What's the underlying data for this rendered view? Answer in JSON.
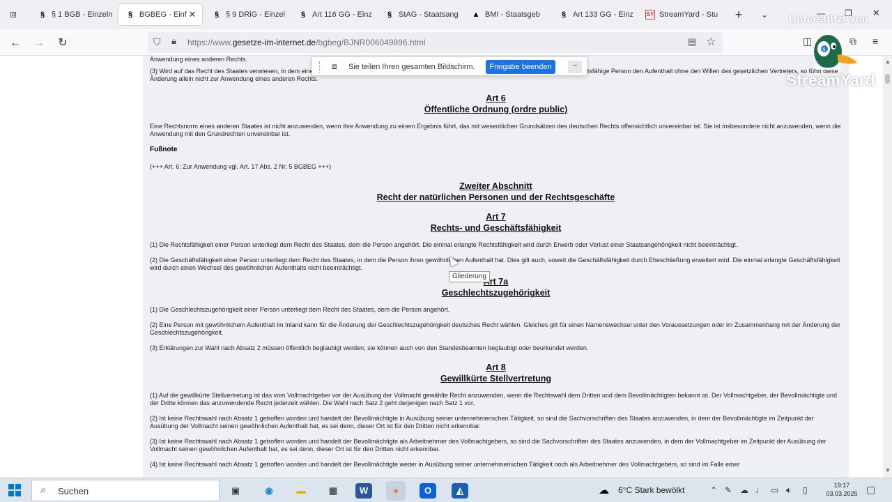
{
  "browser": {
    "tabs": [
      {
        "label": "§ 1 BGB - Einzeln",
        "icon": "gesetze-icon"
      },
      {
        "label": "BGBEG - Einfü",
        "icon": "gesetze-icon",
        "active": true
      },
      {
        "label": "§ 9 DRiG - Einzel",
        "icon": "gesetze-icon"
      },
      {
        "label": "Art 116 GG - Einz",
        "icon": "gesetze-icon"
      },
      {
        "label": "StAG - Staatsang",
        "icon": "gesetze-icon"
      },
      {
        "label": "BMI - Staatsgeb",
        "icon": "bmi-icon"
      },
      {
        "label": "Art 133 GG - Einz",
        "icon": "gesetze-icon"
      },
      {
        "label": "StreamYard - Stu",
        "icon": "streamyard-icon"
      }
    ],
    "tab_favicon_text": "§",
    "streamyard_favicon_text": "SY",
    "url_prefix": "https://www.",
    "url_domain": "gesetze-im-internet.de",
    "url_path": "/bgbeg/BJNR006049896.html"
  },
  "watermarks": {
    "support": "Unterstützt von",
    "brand": "StreamYard"
  },
  "share_bar": {
    "message": "Sie teilen Ihren gesamten Bildschirm.",
    "stop_button": "Freigabe beenden",
    "hide_button": "–"
  },
  "document": {
    "top_fragment": "Anwendung eines anderen Rechts.",
    "art5_para3": "(3) Wird auf das Recht des Staates verwiesen, in dem eine Person ihren Aufenthalt oder ihren gewöhnlichen Aufenthalt hat, und ändert eine nicht voll geschäftsfähige Person den Aufenthalt ohne den Willen des gesetzlichen Vertreters, so führt diese Änderung allein nicht zur Anwendung eines anderen Rechts.",
    "art6": {
      "number": "Art 6",
      "title": "Öffentliche Ordnung (ordre public)",
      "text": "Eine Rechtsnorm eines anderen Staates ist nicht anzuwenden, wenn ihre Anwendung zu einem Ergebnis führt, das mit wesentlichen Grundsätzen des deutschen Rechts offensichtlich unvereinbar ist. Sie ist insbesondere nicht anzuwenden, wenn die Anwendung mit den Grundrechten unvereinbar ist.",
      "footnote_label": "Fußnote",
      "footnote_text": "(+++ Art. 6: Zur Anwendung vgl. Art. 17 Abs. 2 Nr. 5 BGBEG +++)"
    },
    "section2": {
      "number": "Zweiter Abschnitt",
      "title": "Recht der natürlichen Personen und der Rechtsgeschäfte"
    },
    "art7": {
      "number": "Art 7",
      "title": "Rechts- und Geschäftsfähigkeit",
      "p1": "(1) Die Rechtsfähigkeit einer Person unterliegt dem Recht des Staates, dem die Person angehört. Die einmal erlangte Rechtsfähigkeit wird durch Erwerb oder Verlust einer Staatsangehörigkeit nicht beeinträchtigt.",
      "p2": "(2) Die Geschäftsfähigkeit einer Person unterliegt dem Recht des Staates, in dem die Person ihren gewöhnlichen Aufenthalt hat. Dies gilt auch, soweit die Geschäftsfähigkeit durch Eheschließung erweitert wird. Die einmal erlangte Geschäftsfähigkeit wird durch einen Wechsel des gewöhnlichen Aufenthalts nicht beeinträchtigt."
    },
    "art7a": {
      "number": "Art 7a",
      "title": "Geschlechtszugehörigkeit",
      "p1": "(1) Die Geschlechtszugehörigkeit einer Person unterliegt dem Recht des Staates, dem die Person angehört.",
      "p2": "(2) Eine Person mit gewöhnlichem Aufenthalt im Inland kann für die Änderung der Geschlechtszugehörigkeit deutsches Recht wählen. Gleiches gilt für einen Namenswechsel unter den Voraussetzungen oder im Zusammenhang mit der Änderung der Geschlechtszugehörigkeit.",
      "p3": "(3) Erklärungen zur Wahl nach Absatz 2 müssen öffentlich beglaubigt werden; sie können auch von den Standesbeamten beglaubigt oder beurkundet werden."
    },
    "art8": {
      "number": "Art 8",
      "title": "Gewillkürte Stellvertretung",
      "p1": "(1) Auf die gewillkürte Stellvertretung ist das vom Vollmachtgeber vor der Ausübung der Vollmacht gewählte Recht anzuwenden, wenn die Rechtswahl dem Dritten und dem Bevollmächtigten bekannt ist. Der Vollmachtgeber, der Bevollmächtigte und der Dritte können das anzuwendende Recht jederzeit wählen. Die Wahl nach Satz 2 geht derjenigen nach Satz 1 vor.",
      "p2": "(2) Ist keine Rechtswahl nach Absatz 1 getroffen worden und handelt der Bevollmächtigte in Ausübung seiner unternehmerischen Tätigkeit, so sind die Sachvorschriften des Staates anzuwenden, in dem der Bevollmächtigte im Zeitpunkt der Ausübung der Vollmacht seinen gewöhnlichen Aufenthalt hat, es sei denn, dieser Ort ist für den Dritten nicht erkennbar.",
      "p3": "(3) Ist keine Rechtswahl nach Absatz 1 getroffen worden und handelt der Bevollmächtigte als Arbeitnehmer des Vollmachtgebers, so sind die Sachvorschriften des Staates anzuwenden, in dem der Vollmachtgeber im Zeitpunkt der Ausübung der Vollmacht seinen gewöhnlichen Aufenthalt hat, es sei denn, dieser Ort ist für den Dritten nicht erkennbar.",
      "p4": "(4) Ist keine Rechtswahl nach Absatz 1 getroffen worden und handelt der Bevollmächtigte weder in Ausübung seiner unternehmerischen Tätigkeit noch als Arbeitnehmer des Vollmachtgebers, so sind im Falle einer"
    }
  },
  "tooltip": "Gliederung",
  "taskbar": {
    "search_label": "Suchen",
    "weather": "6°C  Stark bewölkt",
    "time": "19:17",
    "date": "03.03.2025"
  },
  "colors": {
    "accent_blue": "#1a73e8",
    "windows_blue": "#0078d4",
    "document_bg": "#eef0f3"
  }
}
